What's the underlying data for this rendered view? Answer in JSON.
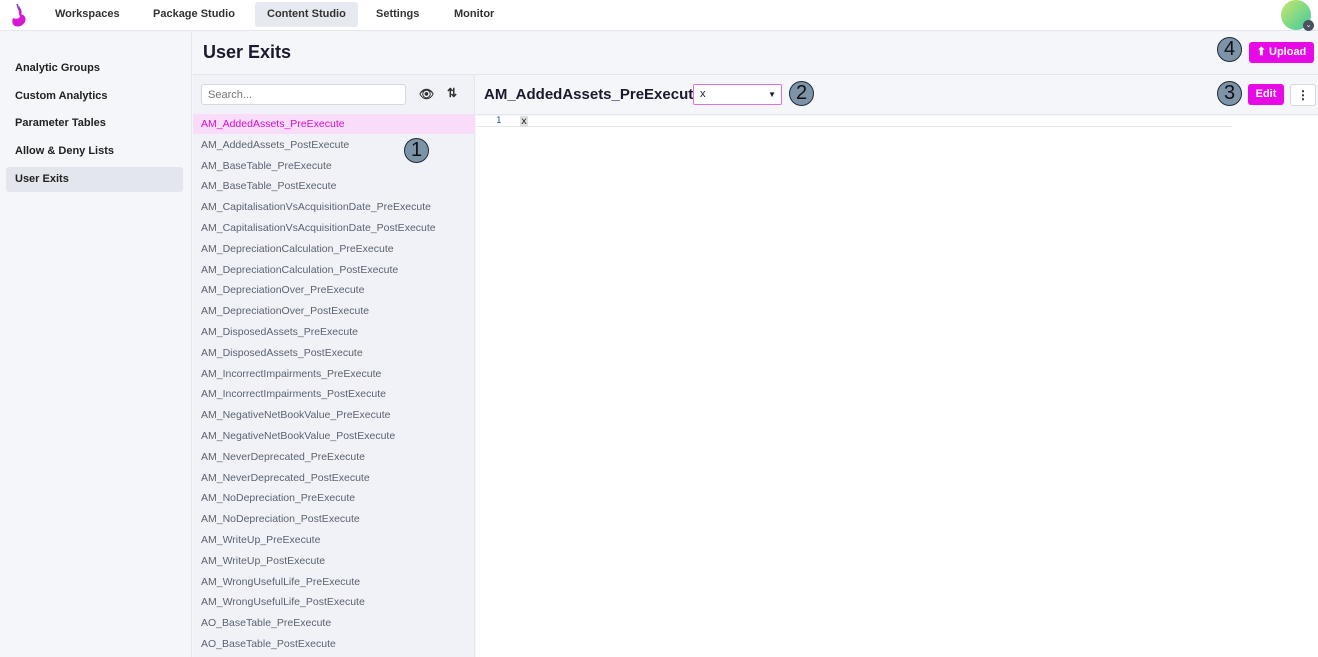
{
  "nav": {
    "items": [
      "Workspaces",
      "Package Studio",
      "Content Studio",
      "Settings",
      "Monitor"
    ],
    "active": "Content Studio"
  },
  "sidebar": {
    "items": [
      "Analytic Groups",
      "Custom Analytics",
      "Parameter Tables",
      "Allow & Deny Lists",
      "User Exits"
    ],
    "active": "User Exits"
  },
  "page": {
    "title": "User Exits",
    "upload_label": "Upload"
  },
  "list": {
    "search_placeholder": "Search...",
    "items": [
      "AM_AddedAssets_PreExecute",
      "AM_AddedAssets_PostExecute",
      "AM_BaseTable_PreExecute",
      "AM_BaseTable_PostExecute",
      "AM_CapitalisationVsAcquisitionDate_PreExecute",
      "AM_CapitalisationVsAcquisitionDate_PostExecute",
      "AM_DepreciationCalculation_PreExecute",
      "AM_DepreciationCalculation_PostExecute",
      "AM_DepreciationOver_PreExecute",
      "AM_DepreciationOver_PostExecute",
      "AM_DisposedAssets_PreExecute",
      "AM_DisposedAssets_PostExecute",
      "AM_IncorrectImpairments_PreExecute",
      "AM_IncorrectImpairments_PostExecute",
      "AM_NegativeNetBookValue_PreExecute",
      "AM_NegativeNetBookValue_PostExecute",
      "AM_NeverDeprecated_PreExecute",
      "AM_NeverDeprecated_PostExecute",
      "AM_NoDepreciation_PreExecute",
      "AM_NoDepreciation_PostExecute",
      "AM_WriteUp_PreExecute",
      "AM_WriteUp_PostExecute",
      "AM_WrongUsefulLife_PreExecute",
      "AM_WrongUsefulLife_PostExecute",
      "AO_BaseTable_PreExecute",
      "AO_BaseTable_PostExecute"
    ]
  },
  "editor": {
    "title": "AM_AddedAssets_PreExecute",
    "language_value": "x",
    "edit_label": "Edit",
    "line_number": "1",
    "code": "x"
  },
  "badges": [
    "1",
    "2",
    "3",
    "4"
  ],
  "colors": {
    "accent": "#e70ae7"
  }
}
